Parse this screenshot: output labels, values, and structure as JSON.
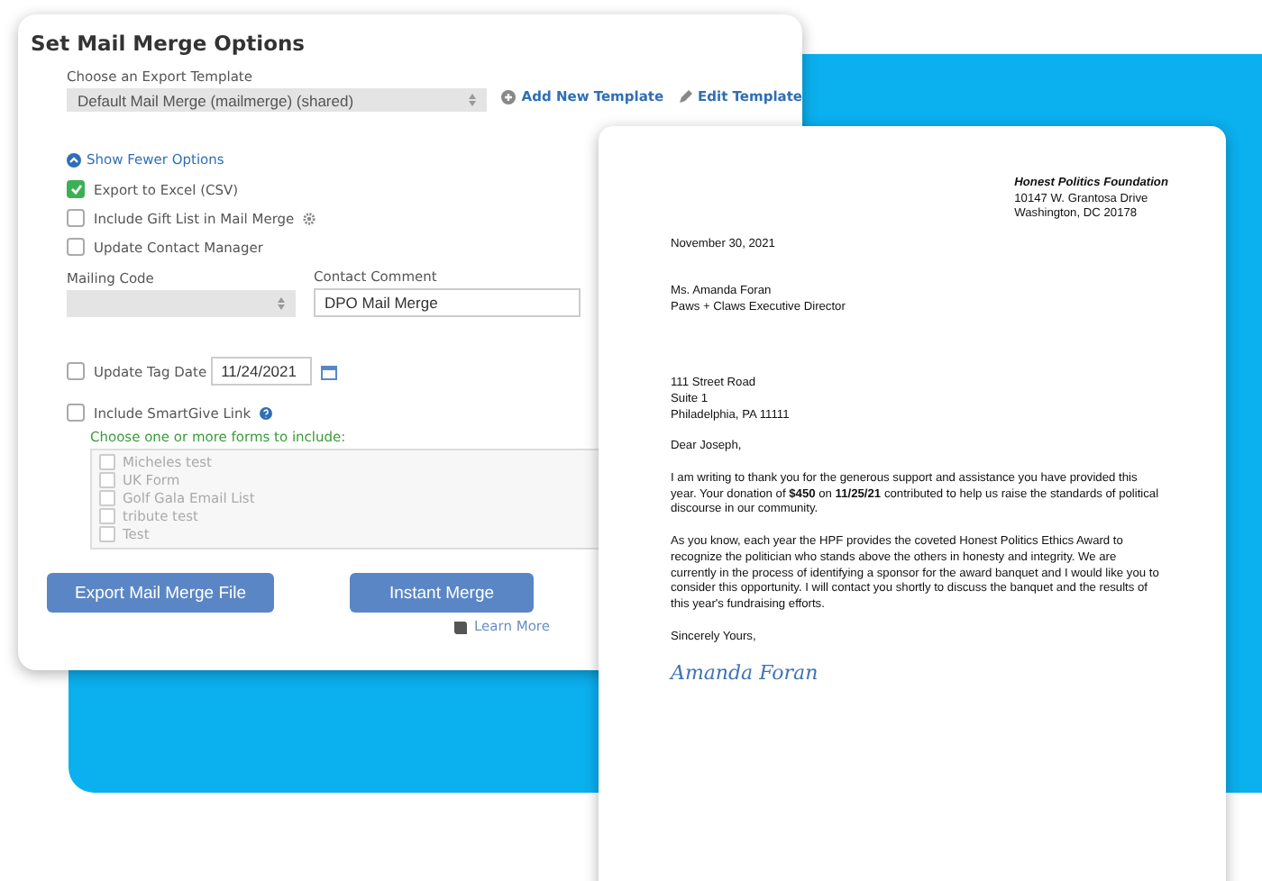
{
  "options_panel": {
    "title": "Set Mail Merge Options",
    "template": {
      "label": "Choose an Export Template",
      "value": "Default Mail Merge (mailmerge) (shared)",
      "add_link": "Add New Template",
      "edit_link": "Edit Template"
    },
    "toggle_link": "Show Fewer Options",
    "checkboxes": [
      {
        "label": "Export to Excel (CSV)",
        "checked": true,
        "kind": "plain"
      },
      {
        "label": "Include Gift List in Mail Merge",
        "checked": false,
        "kind": "settings"
      },
      {
        "label": "Update Contact Manager",
        "checked": false,
        "kind": "plain"
      }
    ],
    "mailing_code": {
      "label": "Mailing Code"
    },
    "contact_comment": {
      "label": "Contact Comment",
      "value": "DPO Mail Merge"
    },
    "tag_date": {
      "label": "Update Tag Date",
      "checked": false,
      "value": "11/24/2021"
    },
    "smartgive": {
      "label": "Include SmartGive Link",
      "checked": false,
      "hint": "Choose one or more forms to include:",
      "forms": [
        {
          "label": "Micheles test",
          "checked": false
        },
        {
          "label": "UK Form",
          "checked": false
        },
        {
          "label": "Golf Gala Email List",
          "checked": false
        },
        {
          "label": "tribute test",
          "checked": false
        },
        {
          "label": "Test",
          "checked": false
        }
      ]
    },
    "buttons": [
      "Export Mail Merge File",
      "Instant Merge"
    ],
    "learn_more": "Learn More"
  },
  "letter": {
    "org": "Honest Politics Foundation",
    "org_address": [
      "10147 W. Grantosa Drive",
      "Washington, DC 20178"
    ],
    "date": "November 30, 2021",
    "recipient": [
      "Ms. Amanda Foran",
      "Paws + Claws Executive Director"
    ],
    "address": [
      "111 Street Road",
      "Suite 1",
      "Philadelphia, PA  11111"
    ],
    "salutation": "Dear Joseph,",
    "paragraphs": [
      "I am writing to thank you for the generous support and assistance you have provided this year.  Your donation of **$450** on **11/25/21** contributed to help us raise the standards of political discourse in our community.",
      "As you know, each year the HPF provides the coveted Honest Politics Ethics Award to recognize the politician who stands above the others in honesty and integrity.  We are currently in the process of identifying a sponsor for the award banquet and I would like you to consider this opportunity.  I will contact you shortly to discuss the banquet and the results of this year's fundraising efforts."
    ],
    "closing": "Sincerely Yours,",
    "signature": "Amanda Foran"
  }
}
